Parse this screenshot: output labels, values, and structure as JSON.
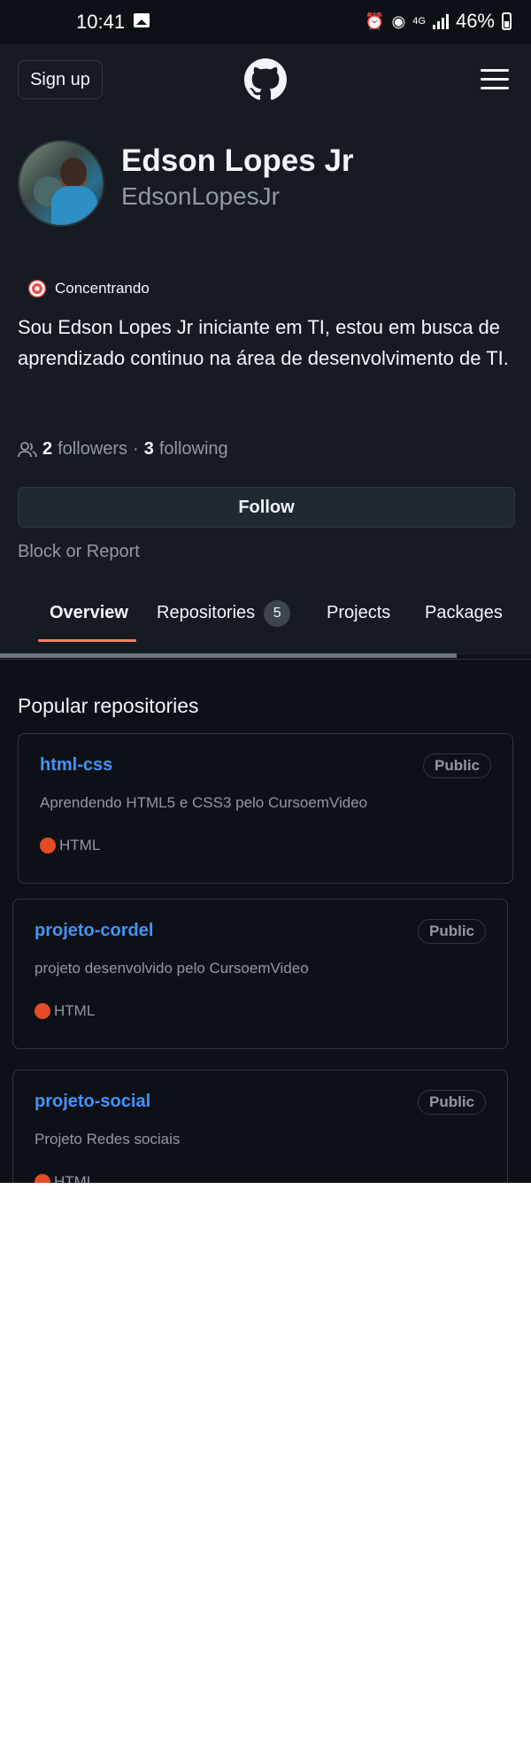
{
  "status_bar": {
    "time": "10:41",
    "network": "4G",
    "battery": "46%"
  },
  "header": {
    "signup_label": "Sign up"
  },
  "profile": {
    "name": "Edson Lopes Jr",
    "login": "EdsonLopesJr",
    "status": "Concentrando",
    "bio": "Sou Edson Lopes Jr iniciante em TI, estou em busca de aprendizado continuo na área de desenvolvimento de TI.",
    "followers_count": "2",
    "followers_label": "followers",
    "separator": "·",
    "following_count": "3",
    "following_label": "following",
    "follow_label": "Follow",
    "block_label": "Block or Report"
  },
  "tabs": [
    {
      "label": "Overview"
    },
    {
      "label": "Repositories",
      "count": "5"
    },
    {
      "label": "Projects"
    },
    {
      "label": "Packages"
    }
  ],
  "popular": {
    "title": "Popular repositories",
    "repos": [
      {
        "name": "html-css",
        "visibility": "Public",
        "description": "Aprendendo HTML5 e CSS3 pelo CursoemVideo",
        "language": "HTML",
        "language_color": "#e34c26"
      },
      {
        "name": "projeto-cordel",
        "visibility": "Public",
        "description": "projeto desenvolvido pelo CursoemVideo",
        "language": "HTML",
        "language_color": "#e34c26"
      },
      {
        "name": "projeto-social",
        "visibility": "Public",
        "description": "Projeto Redes sociais",
        "language": "HTML",
        "language_color": "#e34c26"
      }
    ]
  },
  "colors": {
    "background": "#0d1117",
    "link": "#4493f8",
    "tab_underline": "#f78166"
  }
}
